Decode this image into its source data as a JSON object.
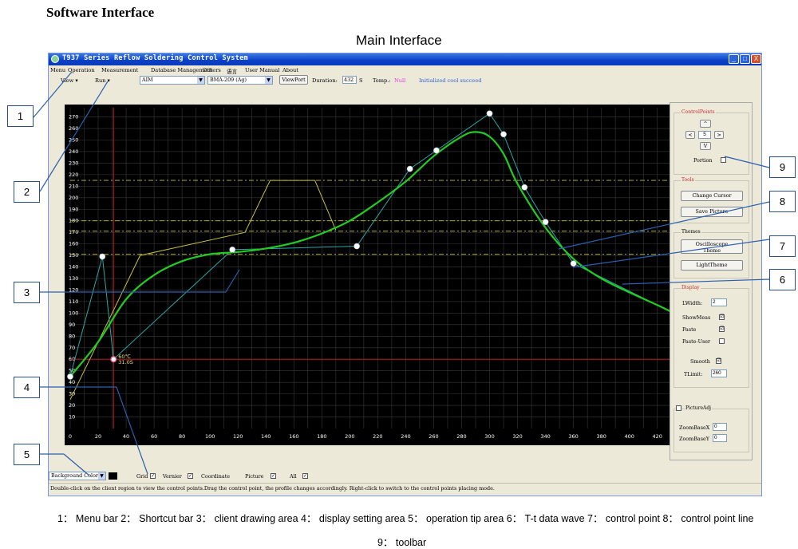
{
  "doc_title": "Software Interface",
  "main_caption": "Main Interface",
  "window": {
    "title": "T937 Series Reflow Soldering Control System",
    "controls": [
      "_",
      "□",
      "X"
    ]
  },
  "menu": [
    "Menu",
    "Operation",
    "Measurement",
    "Database Management",
    "Others",
    "语言",
    "User Manual",
    "About"
  ],
  "shortcut": {
    "view": "View ▾",
    "run": "Run ▾",
    "profile_combo": "AIM",
    "solder_combo": "BMA-209 (Ag)",
    "viewport": "ViewPort",
    "duration_label": "Duration:",
    "duration_value": "432",
    "duration_unit": "S",
    "temp_label": "Temp.:",
    "temp_value": "Null",
    "status": "Initialized cool succeed"
  },
  "plot": {
    "y_ticks": [
      "270",
      "260",
      "250",
      "240",
      "230",
      "220",
      "210",
      "200",
      "190",
      "180",
      "170",
      "160",
      "150",
      "140",
      "130",
      "120",
      "110",
      "100",
      "90",
      "80",
      "70",
      "60",
      "50",
      "40",
      "30",
      "20",
      "10"
    ],
    "x_ticks": [
      "0",
      "20",
      "40",
      "60",
      "80",
      "100",
      "120",
      "140",
      "160",
      "180",
      "200",
      "220",
      "240",
      "260",
      "280",
      "300",
      "320",
      "340",
      "360",
      "380",
      "400",
      "420"
    ],
    "cursor_temp": "60℃",
    "cursor_time": "31.0S",
    "colors": {
      "background": "#000000",
      "grid": "#3a3a3a",
      "wave": "#22cc22",
      "control_line": "#2aa6a6",
      "limit_line": "#c8c040",
      "cursor": "#c01818",
      "point": "#ffffff"
    }
  },
  "right_panel": {
    "control_points": {
      "label": "ControlPoints",
      "up": "^",
      "left": "<",
      "value": "5",
      "right": ">",
      "down": "V",
      "portion": "Portion"
    },
    "tools": {
      "label": "Tools",
      "change_cursor": "Change Cursor",
      "save_picture": "Save Picture"
    },
    "themes": {
      "label": "Themes",
      "oscilloscope_line1": "Oscilloscope",
      "oscilloscope_line2": "Theme",
      "light": "LightTheme"
    },
    "display": {
      "label": "Display",
      "lwidth": "LWidth:",
      "lwidth_value": "2",
      "showmeas": "ShowMeas",
      "paste": "Paste",
      "paste_user": "Paste-User",
      "smooth": "Smooth",
      "tlimit": "TLimit:",
      "tlimit_value": "260",
      "check": "☑"
    },
    "picture_adj": {
      "label": "PictureAdj",
      "zoom_x": "ZoomBaseX",
      "zoom_y": "ZoomBaseY",
      "zoom_x_value": "0",
      "zoom_y_value": "0"
    }
  },
  "display_settings": {
    "bg_color": "Background Color",
    "grid": "Grid",
    "vernier": "Vernier",
    "coordinate": "Coordinate",
    "picture": "Picture",
    "all": "All"
  },
  "status_tip": "Double-click on the client region to view the control points.Drag the control point, the profile changes accordingly. Right-click to switch to the control points placing mode.",
  "callouts": [
    "1",
    "2",
    "3",
    "4",
    "5",
    "6",
    "7",
    "8",
    "9"
  ],
  "legend_line1": "1： Menu bar 2： Shortcut bar 3： client drawing area 4： display setting area 5： operation tip area 6： T-t data wave 7： control point 8： control point line",
  "legend_line2": "9： toolbar",
  "chart_data": {
    "type": "line",
    "xlabel": "",
    "ylabel": "",
    "xlim": [
      0,
      435
    ],
    "ylim": [
      0,
      278
    ],
    "series": [
      {
        "kind": "control_points",
        "x": [
          0,
          23,
          31,
          116,
          205,
          243,
          262,
          300,
          310,
          325,
          340,
          360,
          435
        ],
        "y": [
          45,
          149,
          60,
          155,
          158,
          225,
          241,
          273,
          255,
          209,
          179,
          143,
          98
        ]
      },
      {
        "kind": "wave",
        "x": [
          0,
          20,
          40,
          60,
          80,
          100,
          120,
          140,
          160,
          180,
          200,
          220,
          240,
          260,
          280,
          290,
          300,
          310,
          320,
          340,
          360,
          380,
          400,
          420,
          435
        ],
        "y": [
          45,
          75,
          112,
          133,
          145,
          151,
          153,
          156,
          161,
          169,
          180,
          196,
          214,
          236,
          253,
          257,
          253,
          238,
          212,
          174,
          147,
          130,
          118,
          107,
          98
        ]
      },
      {
        "kind": "limit",
        "x": [
          0,
          50,
          125,
          143,
          175,
          190
        ],
        "y": [
          25,
          150,
          170,
          215,
          215,
          172
        ]
      }
    ],
    "h_lines": [
      215,
      180,
      171,
      151
    ],
    "cursor": {
      "x": 31,
      "y": 60
    }
  }
}
